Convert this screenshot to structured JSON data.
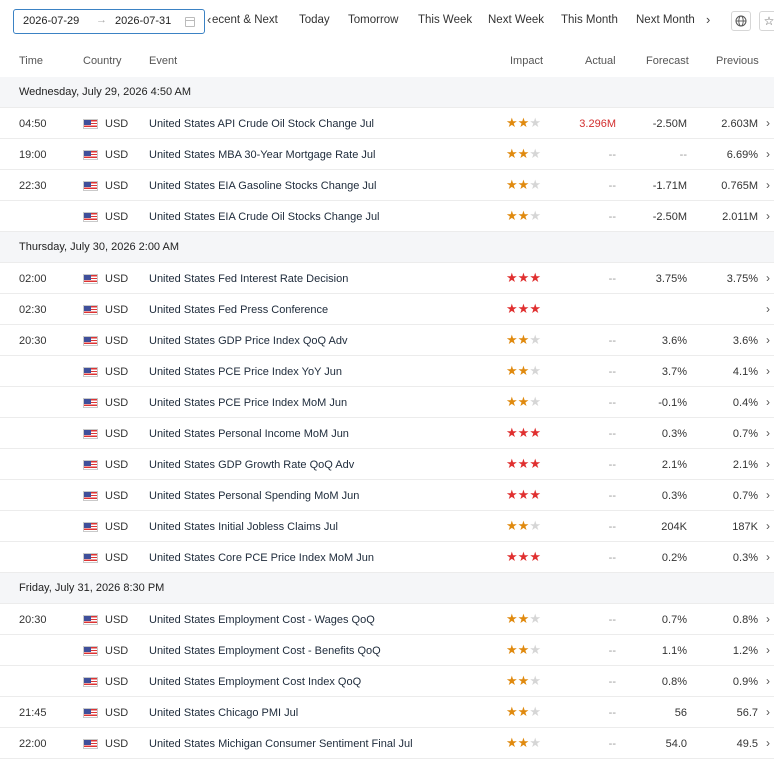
{
  "toolbar": {
    "date_from": "2026-07-29",
    "date_arrow": "→",
    "date_to": "2026-07-31",
    "prev_icon": "chevron-left-icon",
    "next_icon": "chevron-right-icon",
    "tabs": [
      "ecent & Next",
      "Today",
      "Tomorrow",
      "This Week",
      "Next Week",
      "This Month",
      "Next Month"
    ],
    "globe_icon": "globe-icon",
    "star_icon": "star-icon"
  },
  "columns": {
    "time": "Time",
    "country": "Country",
    "event": "Event",
    "impact": "Impact",
    "actual": "Actual",
    "forecast": "Forecast",
    "previous": "Previous"
  },
  "colors": {
    "accent_border": "#3b82c4",
    "star_medium": "#e08a0f",
    "star_high": "#e03030",
    "actual_highlight": "#d32f2f"
  },
  "rows": [
    {
      "type": "section",
      "label": "Wednesday, July 29, 2026 4:50 AM"
    },
    {
      "type": "event",
      "time": "04:50",
      "currency": "USD",
      "event": "United States API Crude Oil Stock Change Jul",
      "impact": 2,
      "actual": "3.296M",
      "actual_color": "red",
      "forecast": "-2.50M",
      "previous": "2.603M"
    },
    {
      "type": "event",
      "time": "19:00",
      "currency": "USD",
      "event": "United States MBA 30-Year Mortgage Rate Jul",
      "impact": 2,
      "actual": "--",
      "forecast": "--",
      "previous": "6.69%"
    },
    {
      "type": "event",
      "time": "22:30",
      "currency": "USD",
      "event": "United States EIA Gasoline Stocks Change Jul",
      "impact": 2,
      "actual": "--",
      "forecast": "-1.71M",
      "previous": "0.765M"
    },
    {
      "type": "event",
      "time": "",
      "currency": "USD",
      "event": "United States EIA Crude Oil Stocks Change Jul",
      "impact": 2,
      "actual": "--",
      "forecast": "-2.50M",
      "previous": "2.011M"
    },
    {
      "type": "section",
      "label": "Thursday, July 30, 2026 2:00 AM"
    },
    {
      "type": "event",
      "time": "02:00",
      "currency": "USD",
      "event": "United States Fed Interest Rate Decision",
      "impact": 3,
      "actual": "--",
      "forecast": "3.75%",
      "previous": "3.75%"
    },
    {
      "type": "event",
      "time": "02:30",
      "currency": "USD",
      "event": "United States Fed Press Conference",
      "impact": 3,
      "actual": "",
      "forecast": "",
      "previous": ""
    },
    {
      "type": "event",
      "time": "20:30",
      "currency": "USD",
      "event": "United States GDP Price Index QoQ Adv",
      "impact": 2,
      "actual": "--",
      "forecast": "3.6%",
      "previous": "3.6%"
    },
    {
      "type": "event",
      "time": "",
      "currency": "USD",
      "event": "United States PCE Price Index YoY Jun",
      "impact": 2,
      "actual": "--",
      "forecast": "3.7%",
      "previous": "4.1%"
    },
    {
      "type": "event",
      "time": "",
      "currency": "USD",
      "event": "United States PCE Price Index MoM Jun",
      "impact": 2,
      "actual": "--",
      "forecast": "-0.1%",
      "previous": "0.4%"
    },
    {
      "type": "event",
      "time": "",
      "currency": "USD",
      "event": "United States Personal Income MoM Jun",
      "impact": 3,
      "actual": "--",
      "forecast": "0.3%",
      "previous": "0.7%"
    },
    {
      "type": "event",
      "time": "",
      "currency": "USD",
      "event": "United States GDP Growth Rate QoQ Adv",
      "impact": 3,
      "actual": "--",
      "forecast": "2.1%",
      "previous": "2.1%"
    },
    {
      "type": "event",
      "time": "",
      "currency": "USD",
      "event": "United States Personal Spending MoM Jun",
      "impact": 3,
      "actual": "--",
      "forecast": "0.3%",
      "previous": "0.7%"
    },
    {
      "type": "event",
      "time": "",
      "currency": "USD",
      "event": "United States Initial Jobless Claims Jul",
      "impact": 2,
      "actual": "--",
      "forecast": "204K",
      "previous": "187K"
    },
    {
      "type": "event",
      "time": "",
      "currency": "USD",
      "event": "United States Core PCE Price Index MoM Jun",
      "impact": 3,
      "actual": "--",
      "forecast": "0.2%",
      "previous": "0.3%"
    },
    {
      "type": "section",
      "label": "Friday, July 31, 2026 8:30 PM"
    },
    {
      "type": "event",
      "time": "20:30",
      "currency": "USD",
      "event": "United States Employment Cost - Wages QoQ",
      "impact": 2,
      "actual": "--",
      "forecast": "0.7%",
      "previous": "0.8%"
    },
    {
      "type": "event",
      "time": "",
      "currency": "USD",
      "event": "United States Employment Cost - Benefits QoQ",
      "impact": 2,
      "actual": "--",
      "forecast": "1.1%",
      "previous": "1.2%"
    },
    {
      "type": "event",
      "time": "",
      "currency": "USD",
      "event": "United States Employment Cost Index QoQ",
      "impact": 2,
      "actual": "--",
      "forecast": "0.8%",
      "previous": "0.9%"
    },
    {
      "type": "event",
      "time": "21:45",
      "currency": "USD",
      "event": "United States Chicago PMI Jul",
      "impact": 2,
      "actual": "--",
      "forecast": "56",
      "previous": "56.7"
    },
    {
      "type": "event",
      "time": "22:00",
      "currency": "USD",
      "event": "United States Michigan Consumer Sentiment Final Jul",
      "impact": 2,
      "actual": "--",
      "forecast": "54.0",
      "previous": "49.5"
    }
  ]
}
